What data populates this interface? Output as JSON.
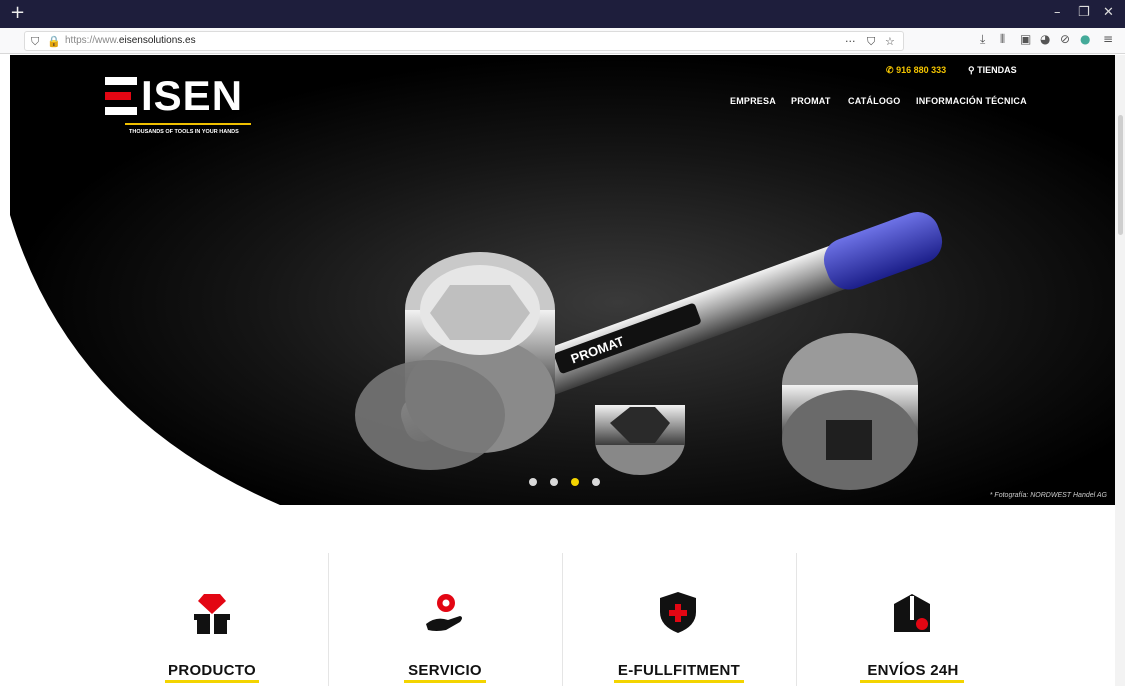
{
  "browser": {
    "new_tab_glyph": "+",
    "url_prefix": "https://www.",
    "url_domain": "eisensolutions.es",
    "page_actions_glyph": "···",
    "window_controls": [
      "–",
      "❐",
      "✕"
    ]
  },
  "header": {
    "logo_text": "ISEN",
    "logo_tagline": "THOUSANDS OF TOOLS IN YOUR HANDS",
    "phone": "916 880 333",
    "stores": "TIENDAS",
    "nav": [
      "EMPRESA",
      "PROMAT",
      "CATÁLOGO",
      "INFORMACIÓN TÉCNICA"
    ]
  },
  "hero": {
    "brand_on_tool": "PROMAT",
    "photo_credit": "* Fotografía: NORDWEST Handel AG",
    "slides_count": 4,
    "active_slide": 3
  },
  "features": [
    {
      "label": "PRODUCTO",
      "icon": "diamond-box-icon"
    },
    {
      "label": "SERVICIO",
      "icon": "gear-hand-icon"
    },
    {
      "label": "E-FULLFITMENT",
      "icon": "shield-plus-icon"
    },
    {
      "label": "ENVÍOS 24H",
      "icon": "shipping-box-icon"
    }
  ],
  "colors": {
    "accent_yellow": "#f3d400",
    "logo_red": "#e30613",
    "browser_titlebar": "#1e1e3c",
    "hero_bg": "#000000"
  }
}
